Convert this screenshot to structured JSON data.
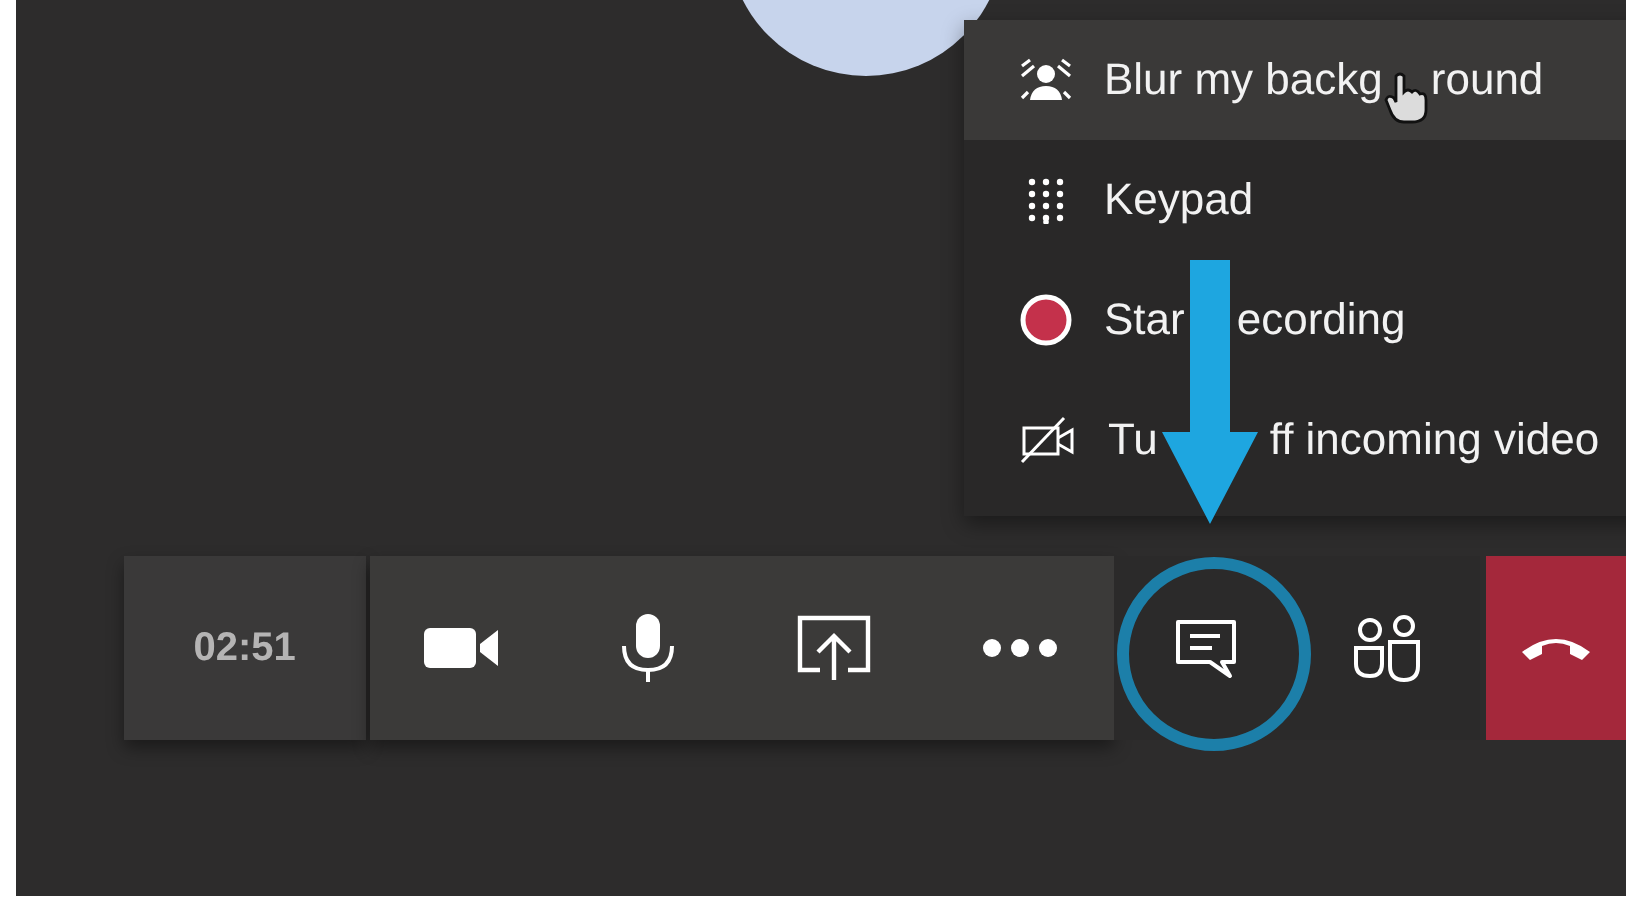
{
  "menu": {
    "items": [
      {
        "kind": "blur",
        "texts": [
          "Blur my backg",
          "round"
        ],
        "selected": true
      },
      {
        "kind": "keypad",
        "texts": [
          "Keypad"
        ],
        "selected": false
      },
      {
        "kind": "record",
        "texts": [
          "Star",
          "ecording"
        ],
        "selected": false
      },
      {
        "kind": "video_off",
        "texts": [
          "Tu",
          "ff incoming video"
        ],
        "selected": false
      }
    ]
  },
  "toolbar": {
    "timer": "02:51",
    "buttons": [
      {
        "kind": "video"
      },
      {
        "kind": "mic"
      },
      {
        "kind": "share"
      },
      {
        "kind": "more"
      },
      {
        "kind": "chat"
      },
      {
        "kind": "people"
      },
      {
        "kind": "hangup"
      }
    ]
  }
}
